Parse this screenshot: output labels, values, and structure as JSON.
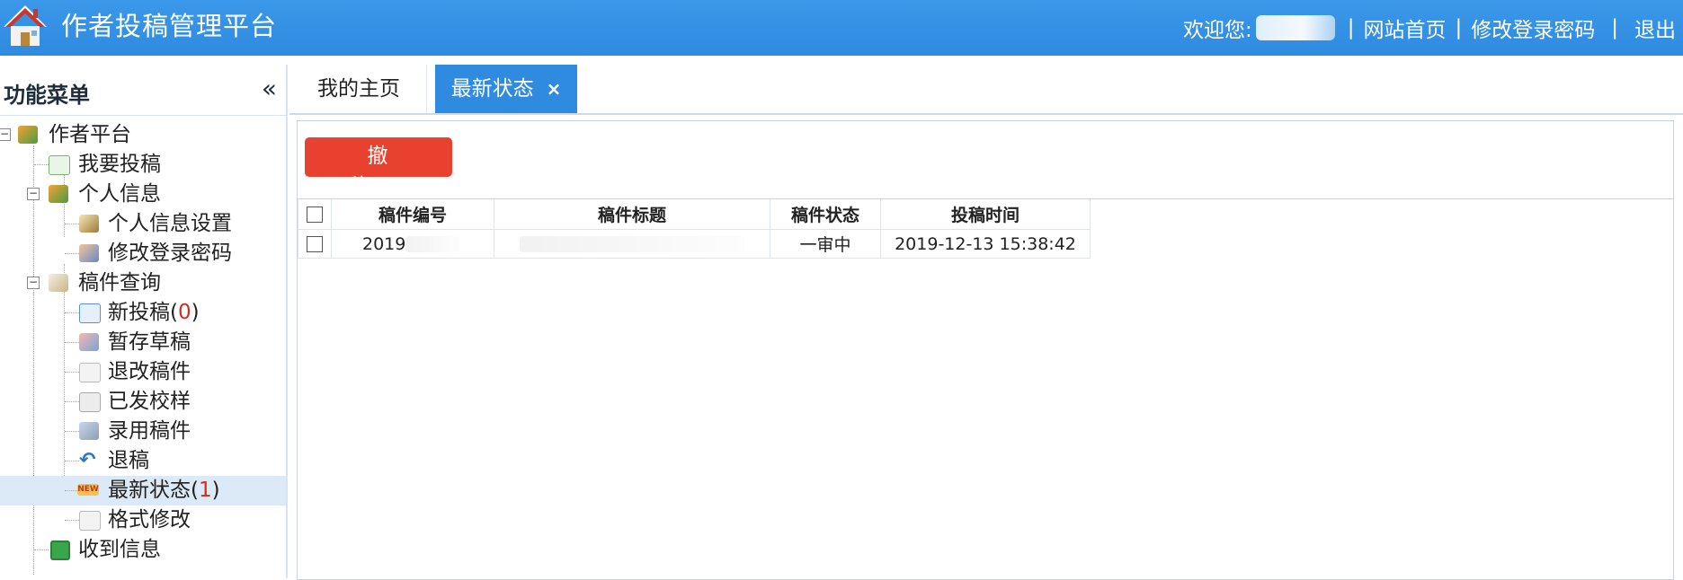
{
  "header": {
    "title": "作者投稿管理平台",
    "welcome_prefix": "欢迎您:",
    "sep": "|",
    "site_home": "网站首页",
    "change_password": "修改登录密码",
    "logout": "退出"
  },
  "sidebar": {
    "title": "功能菜单",
    "collapse_glyph": "«",
    "items": [
      {
        "label": "作者平台",
        "level": 0,
        "icon": "people-icon"
      },
      {
        "label": "我要投稿",
        "level": 1,
        "icon": "add-doc-icon"
      },
      {
        "label": "个人信息",
        "level": 1,
        "icon": "people-icon"
      },
      {
        "label": "个人信息设置",
        "level": 2,
        "icon": "edit-icon"
      },
      {
        "label": "修改登录密码",
        "level": 2,
        "icon": "user-key-icon"
      },
      {
        "label": "稿件查询",
        "level": 1,
        "icon": "search-doc-icon"
      },
      {
        "label": "新投稿(",
        "count": "0",
        "suffix": ")",
        "level": 2,
        "icon": "document-icon"
      },
      {
        "label": "暂存草稿",
        "level": 2,
        "icon": "draft-icon"
      },
      {
        "label": "退改稿件",
        "level": 2,
        "icon": "return-doc-icon"
      },
      {
        "label": "已发校样",
        "level": 2,
        "icon": "proof-icon"
      },
      {
        "label": "录用稿件",
        "level": 2,
        "icon": "accepted-icon"
      },
      {
        "label": "退稿",
        "level": 2,
        "icon": "undo-icon"
      },
      {
        "label": "最新状态(",
        "count": "1",
        "suffix": ")",
        "level": 2,
        "icon": "new-badge-icon"
      },
      {
        "label": "格式修改",
        "level": 2,
        "icon": "format-icon"
      },
      {
        "label": "收到信息",
        "level": 1,
        "icon": "message-icon"
      }
    ]
  },
  "tabs": [
    {
      "label": "我的主页"
    },
    {
      "label": "最新状态",
      "close": "×"
    }
  ],
  "toolbar": {
    "withdraw_label": "撤稿"
  },
  "table": {
    "columns": [
      "稿件编号",
      "稿件标题",
      "稿件状态",
      "投稿时间"
    ],
    "rows": [
      {
        "id": "2019",
        "title": "",
        "status": "一审中",
        "time": "2019-12-13 15:38:42"
      }
    ]
  },
  "colors": {
    "header_blue": "#2f8be0",
    "active_tab": "#2f8be0",
    "withdraw_red": "#e8412f",
    "count_red": "#d12d1f",
    "selected_row": "#dce9f6"
  }
}
